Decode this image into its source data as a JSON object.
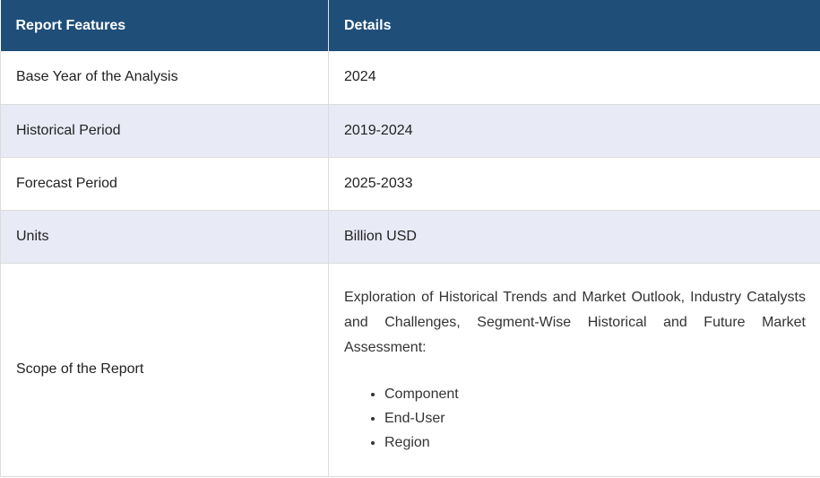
{
  "table": {
    "headers": [
      "Report Features",
      "Details"
    ],
    "rows": [
      {
        "feature": "Base Year of the Analysis",
        "detail": "2024"
      },
      {
        "feature": "Historical Period",
        "detail": "2019-2024"
      },
      {
        "feature": "Forecast Period",
        "detail": "2025-2033"
      },
      {
        "feature": "Units",
        "detail": "Billion USD"
      }
    ],
    "scope": {
      "feature": "Scope of the Report",
      "text": "Exploration of Historical Trends and Market Outlook, Industry Catalysts and Challenges, Segment-Wise Historical and Future Market Assessment:",
      "items": [
        "Component",
        "End-User",
        "Region"
      ]
    }
  },
  "colors": {
    "header_bg": "#1f4e79",
    "alt_row_bg": "#e8eaf6",
    "border": "#dcdcdc"
  }
}
